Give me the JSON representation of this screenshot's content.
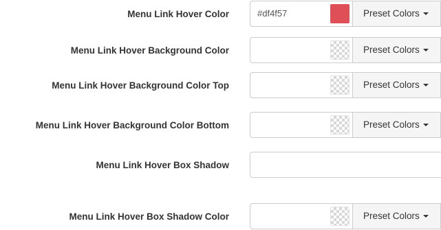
{
  "rows": [
    {
      "label": "Menu Link Hover Color",
      "value": "#df4f57",
      "swatch_color": "#df4f57",
      "preset_label": "Preset Colors"
    },
    {
      "label": "Menu Link Hover Background Color",
      "value": "",
      "swatch_color": "transparent",
      "preset_label": "Preset Colors"
    },
    {
      "label": "Menu Link Hover Background Color Top",
      "value": "",
      "swatch_color": "transparent",
      "preset_label": "Preset Colors"
    },
    {
      "label": "Menu Link Hover Background Color Bottom",
      "value": "",
      "swatch_color": "transparent",
      "preset_label": "Preset Colors"
    },
    {
      "label": "Menu Link Hover Box Shadow",
      "value": ""
    },
    {
      "label": "Menu Link Hover Box Shadow Color",
      "value": "",
      "swatch_color": "transparent",
      "preset_label": "Preset Colors"
    }
  ],
  "icons": {
    "dropdown": "caret-down-icon"
  }
}
